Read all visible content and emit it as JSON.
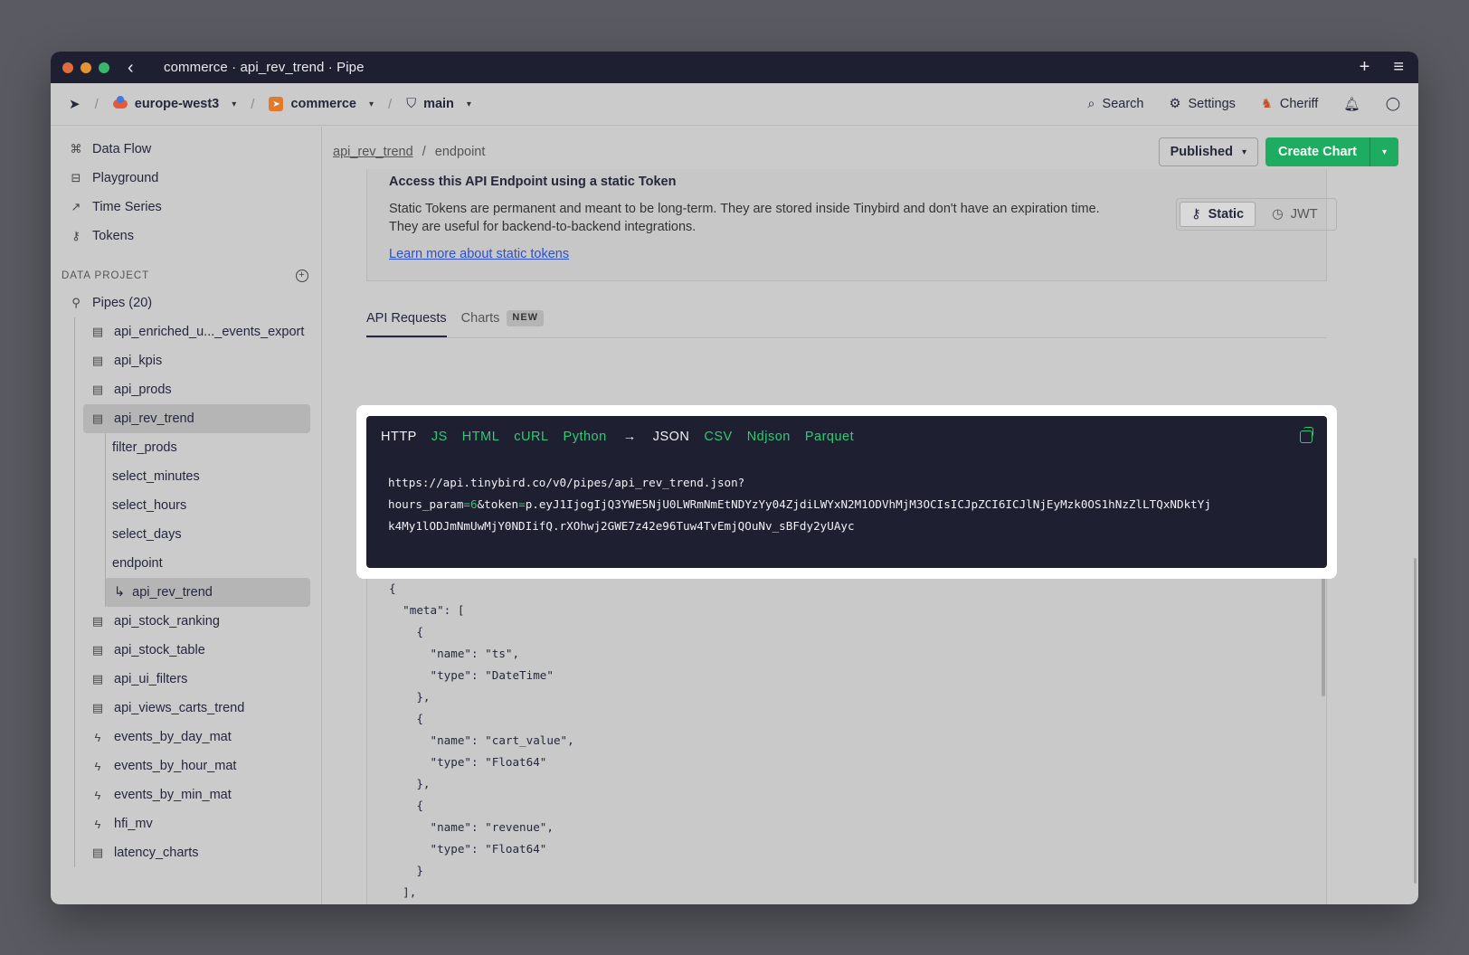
{
  "titlebar": {
    "title": "commerce · api_rev_trend · Pipe"
  },
  "topnav": {
    "region": "europe-west3",
    "workspace": "commerce",
    "branch": "main",
    "search": "Search",
    "settings": "Settings",
    "user": "Cheriff"
  },
  "sidebar": {
    "nav": [
      "Data Flow",
      "Playground",
      "Time Series",
      "Tokens"
    ],
    "section_label": "DATA PROJECT",
    "pipes_label": "Pipes (20)",
    "pipes_before": [
      "api_enriched_u..._events_export",
      "api_kpis",
      "api_prods"
    ],
    "active_pipe": "api_rev_trend",
    "nodes": [
      "filter_prods",
      "select_minutes",
      "select_hours",
      "select_days",
      "endpoint"
    ],
    "active_node": "api_rev_trend",
    "pipes_after": [
      "api_stock_ranking",
      "api_stock_table",
      "api_ui_filters",
      "api_views_carts_trend"
    ],
    "mats": [
      "events_by_day_mat",
      "events_by_hour_mat",
      "events_by_min_mat",
      "hfi_mv"
    ],
    "last": "latency_charts"
  },
  "header": {
    "crumb_pipe": "api_rev_trend",
    "crumb_sep": "/",
    "crumb_node": "endpoint",
    "published": "Published",
    "create_chart": "Create Chart"
  },
  "token_card": {
    "title": "Access this API Endpoint using a static Token",
    "desc": "Static Tokens are permanent and meant to be long-term. They are stored inside Tinybird and don't have an expiration time. They are useful for backend-to-backend integrations.",
    "link": "Learn more about static tokens",
    "static": "Static",
    "jwt": "JWT"
  },
  "tabs": {
    "api": "API Requests",
    "charts": "Charts",
    "badge": "NEW"
  },
  "code": {
    "langs": [
      "HTTP",
      "JS",
      "HTML",
      "cURL",
      "Python"
    ],
    "arrow": "→",
    "formats": [
      "JSON",
      "CSV",
      "Ndjson",
      "Parquet"
    ],
    "url_line1": "https://api.tinybird.co/v0/pipes/api_rev_trend.json?",
    "param_name": "hours_param",
    "param_eq": "=",
    "param_val": "6",
    "token_prefix": "&token",
    "token_eq": "=",
    "token_line2": "p.eyJ1IjogIjQ3YWE5NjU0LWRmNmEtNDYzYy04ZjdiLWYxN2M1ODVhMjM3OCIsICJpZCI6ICJlNjEyMzk0OS1hNzZlLTQxNDktYj",
    "token_line3": "k4My1lODJmNmUwMjY0NDIifQ.rXOhwj2GWE7z42e96Tuw4TvEmjQOuNv_sBFdy2yUAyc"
  },
  "response": {
    "json": "{\n  \"meta\": [\n    {\n      \"name\": \"ts\",\n      \"type\": \"DateTime\"\n    },\n    {\n      \"name\": \"cart_value\",\n      \"type\": \"Float64\"\n    },\n    {\n      \"name\": \"revenue\",\n      \"type\": \"Float64\"\n    }\n  ],"
  }
}
